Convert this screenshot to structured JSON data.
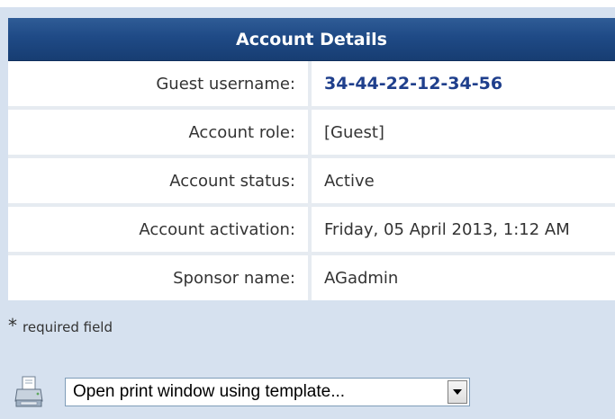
{
  "account_details": {
    "title": "Account Details",
    "rows": [
      {
        "label": "Guest username:",
        "value": "34-44-22-12-34-56"
      },
      {
        "label": "Account role:",
        "value": "[Guest]"
      },
      {
        "label": "Account status:",
        "value": "Active"
      },
      {
        "label": "Account activation:",
        "value": "Friday, 05 April 2013, 1:12 AM"
      },
      {
        "label": "Sponsor name:",
        "value": "AGadmin"
      }
    ]
  },
  "footer": {
    "required_asterisk": "*",
    "required_text": "required field"
  },
  "print": {
    "select_value": "Open print window using template...",
    "icon": "printer-icon"
  },
  "colors": {
    "header_bg": "#1f4a86",
    "panel_bg": "#d6e1ef",
    "username_text": "#1f3f8c"
  }
}
